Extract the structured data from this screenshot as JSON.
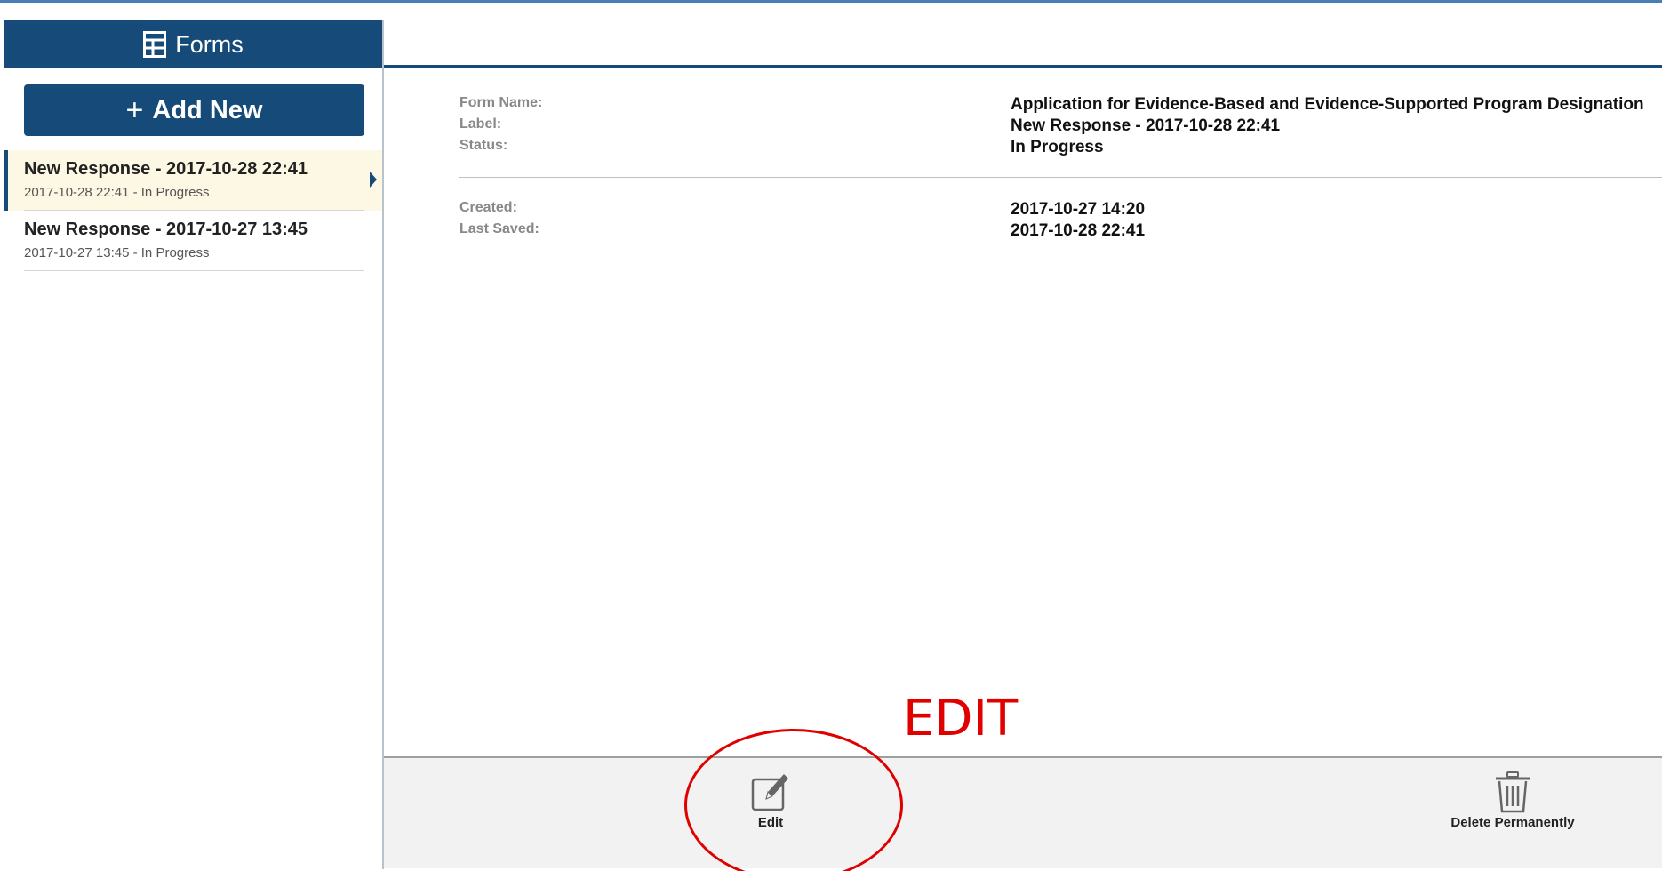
{
  "sidebar": {
    "header_label": "Forms",
    "add_new_label": "Add New",
    "items": [
      {
        "title": "New Response - 2017-10-28 22:41",
        "subtitle": "2017-10-28 22:41 - In Progress",
        "active": true
      },
      {
        "title": "New Response - 2017-10-27 13:45",
        "subtitle": "2017-10-27 13:45 - In Progress",
        "active": false
      }
    ]
  },
  "details": {
    "form_name_label": "Form Name:",
    "form_name_value": "Application for Evidence-Based and Evidence-Supported Program Designation",
    "label_label": "Label:",
    "label_value": "New Response - 2017-10-28 22:41",
    "status_label": "Status:",
    "status_value": "In Progress",
    "created_label": "Created:",
    "created_value": "2017-10-27 14:20",
    "last_saved_label": "Last Saved:",
    "last_saved_value": "2017-10-28 22:41"
  },
  "toolbar": {
    "edit_label": "Edit",
    "delete_label": "Delete Permanently"
  },
  "annotation": {
    "text": "EDIT",
    "color": "#e00000"
  },
  "colors": {
    "brand": "#164a78",
    "active_row": "#fdf8e3"
  },
  "icons": [
    "table-icon",
    "plus-icon",
    "caret-right-icon",
    "edit-icon",
    "trash-icon"
  ]
}
